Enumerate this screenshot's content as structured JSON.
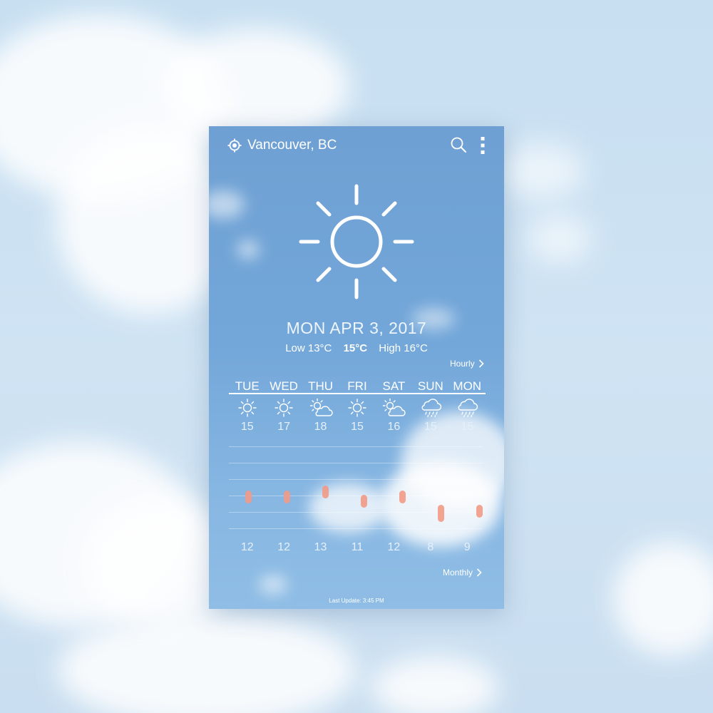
{
  "header": {
    "location": "Vancouver, BC",
    "location_icon": "location-crosshair-icon",
    "search_icon": "search-icon",
    "menu_icon": "more-vertical-icon"
  },
  "today": {
    "condition_icon": "sun-icon",
    "date": "MON APR 3, 2017",
    "low": "Low 13°C",
    "current": "15°C",
    "high": "High 16°C"
  },
  "links": {
    "hourly": "Hourly",
    "monthly": "Monthly"
  },
  "forecast": [
    {
      "day": "TUE",
      "icon": "sun",
      "high": "15",
      "low": "12",
      "high_val": 15,
      "low_val": 12
    },
    {
      "day": "WED",
      "icon": "sun",
      "high": "17",
      "low": "12",
      "high_val": 17,
      "low_val": 12
    },
    {
      "day": "THU",
      "icon": "partly-cloudy",
      "high": "18",
      "low": "13",
      "high_val": 18,
      "low_val": 13
    },
    {
      "day": "FRI",
      "icon": "sun",
      "high": "15",
      "low": "11",
      "high_val": 15,
      "low_val": 11
    },
    {
      "day": "SAT",
      "icon": "partly-cloudy",
      "high": "16",
      "low": "12",
      "high_val": 16,
      "low_val": 12
    },
    {
      "day": "SUN",
      "icon": "rain",
      "high": "15",
      "low": "8",
      "high_val": 15,
      "low_val": 8
    },
    {
      "day": "MON",
      "icon": "rain",
      "high": "15",
      "low": "9",
      "high_val": 15,
      "low_val": 9
    }
  ],
  "colors": {
    "accent_bar": "#f29a86",
    "text": "#ffffff"
  },
  "footer": {
    "last_update": "Last Update: 3:45 PM"
  }
}
